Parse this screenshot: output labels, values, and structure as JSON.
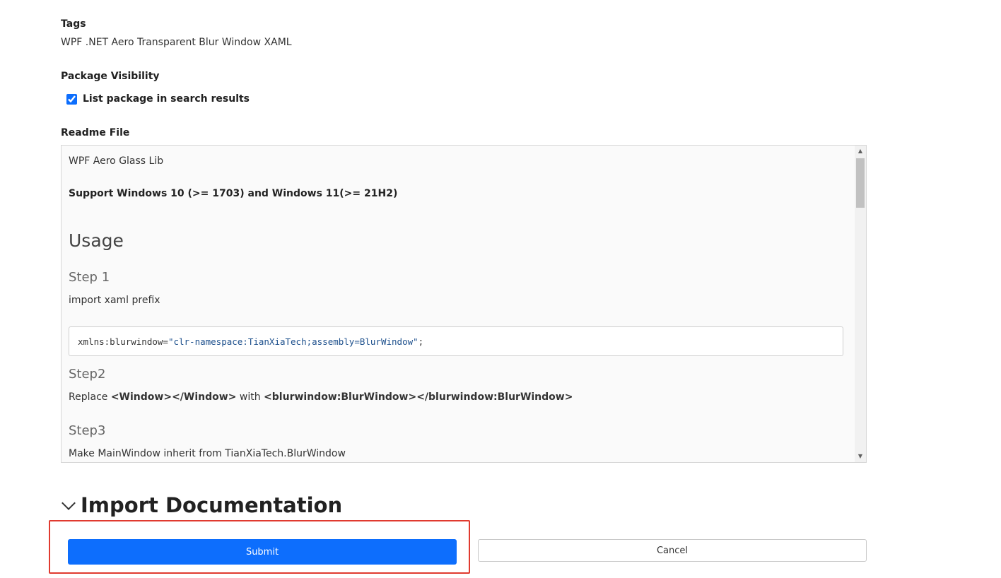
{
  "tags": {
    "label": "Tags",
    "value": "WPF .NET Aero Transparent Blur Window XAML"
  },
  "visibility": {
    "label": "Package Visibility",
    "checkbox_label": "List package in search results",
    "checked": true
  },
  "readme": {
    "label": "Readme File",
    "title_line": "WPF Aero Glass Lib",
    "support_line": "Support Windows 10 (>= 1703) and Windows 11(>= 21H2)",
    "usage_heading": "Usage",
    "step1_heading": "Step 1",
    "step1_text": "import xaml prefix",
    "code_attr": "xmlns:blurwindow=",
    "code_string": "\"clr-namespace:TianXiaTech;assembly=BlurWindow\"",
    "code_end": ";",
    "step2_heading": "Step2",
    "step2_prefix": "Replace ",
    "step2_tag1": "<Window></Window>",
    "step2_with": " with ",
    "step2_tag2": "<blurwindow:BlurWindow></blurwindow:BlurWindow>",
    "step3_heading": "Step3",
    "step3_text": "Make MainWindow inherit from TianXiaTech.BlurWindow"
  },
  "import_section": {
    "title": "Import Documentation"
  },
  "actions": {
    "submit_label": "Submit",
    "cancel_label": "Cancel"
  },
  "colors": {
    "primary": "#0d6efd",
    "highlight": "#e03a2f"
  },
  "icons": {
    "chevron": "chevron-down-icon",
    "scroll_up": "scroll-up-arrow-icon",
    "scroll_down": "scroll-down-arrow-icon"
  }
}
